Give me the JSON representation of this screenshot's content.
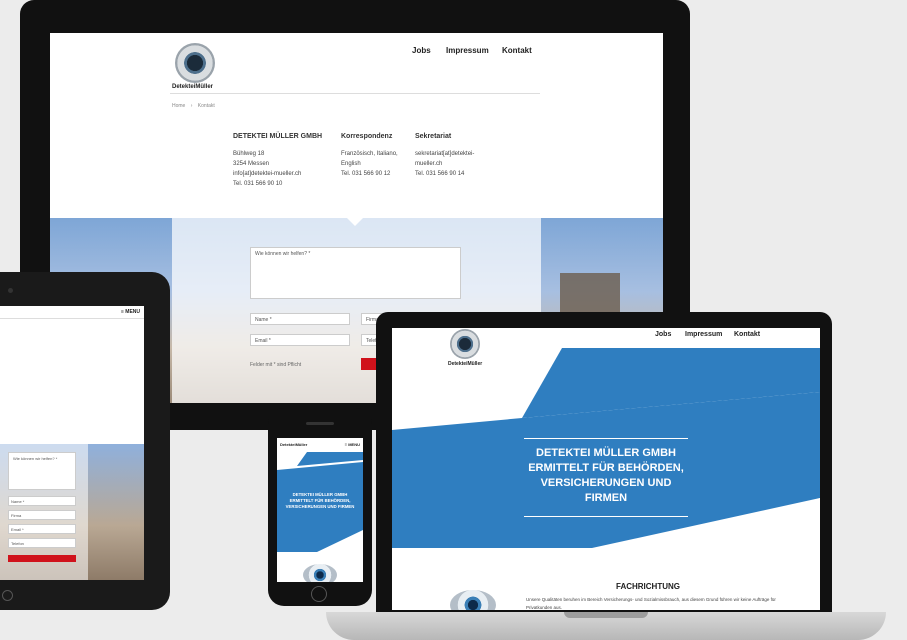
{
  "colors": {
    "accent_blue": "#2f7ec0",
    "cta_red": "#d0121b",
    "bezel": "#111111"
  },
  "brand": {
    "logo_text": "DetekteiMüller"
  },
  "nav": {
    "jobs": "Jobs",
    "impressum": "Impressum",
    "kontakt": "Kontakt",
    "menu": "≡ MENU"
  },
  "breadcrumb": {
    "home": "Home",
    "sep": "›",
    "current": "Kontakt"
  },
  "contact": {
    "company_heading": "DETEKTEI MÜLLER GMBH",
    "company_lines": "Bühlweg 18\n3254 Messen\ninfo[at]detektei-mueller.ch\nTel. 031 566 90 10",
    "corr_heading": "Korrespondenz",
    "corr_lines": "Französisch, Italiano,\nEnglish\nTel. 031 566 90 12",
    "sek_heading": "Sekretariat",
    "sek_lines": "sekretariat[at]detektei-\nmueller.ch\nTel. 031 566 90 14"
  },
  "form": {
    "message_placeholder": "Wie können wir helfen? *",
    "name_placeholder": "Name *",
    "firma_placeholder": "Firma",
    "email_placeholder": "Email *",
    "telefon_placeholder": "Telefon",
    "required_note": "Felder mit * sind Pflicht"
  },
  "hero": {
    "title": "DETEKTEI MÜLLER GMBH ERMITTELT FÜR BEHÖRDEN, VERSICHERUNGEN UND FIRMEN"
  },
  "section": {
    "heading": "FACHRICHTUNG",
    "para": "Unsere Qualitäten beruhen im Bereich Versicherungs- und Sozialmissbrauch, aus diesem Grund führen wir keine Aufträge für Privatkunden aus."
  },
  "icons": [
    "logo-icon",
    "eye-icon",
    "menu-icon"
  ]
}
